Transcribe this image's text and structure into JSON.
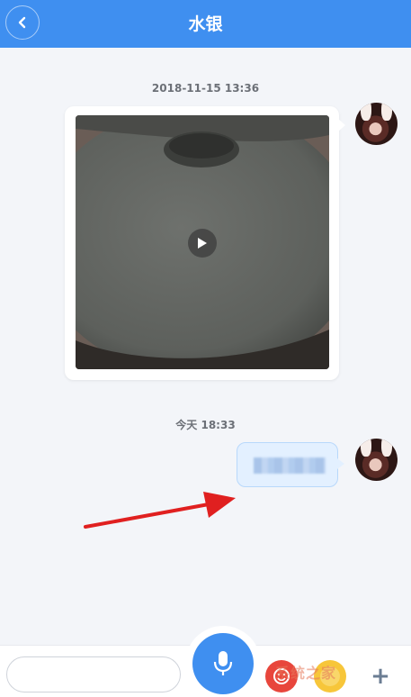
{
  "header": {
    "title": "水银",
    "back_icon": "chevron-left-icon"
  },
  "messages": [
    {
      "timestamp": "2018-11-15 13:36",
      "type": "video",
      "icon": "play-icon"
    },
    {
      "timestamp": "今天 18:33",
      "type": "text",
      "text": ""
    }
  ],
  "input_bar": {
    "text_value": "",
    "mic_icon": "microphone-icon",
    "emoji_icon": "emoji-icon",
    "sticker_icon": "sticker-icon",
    "plus_label": "+"
  },
  "overlay": {
    "watermark": "系统之家"
  },
  "colors": {
    "accent": "#3f8ff0",
    "background": "#f3f5f9",
    "bubble": "#e3f0ff",
    "arrow": "#e02020"
  }
}
